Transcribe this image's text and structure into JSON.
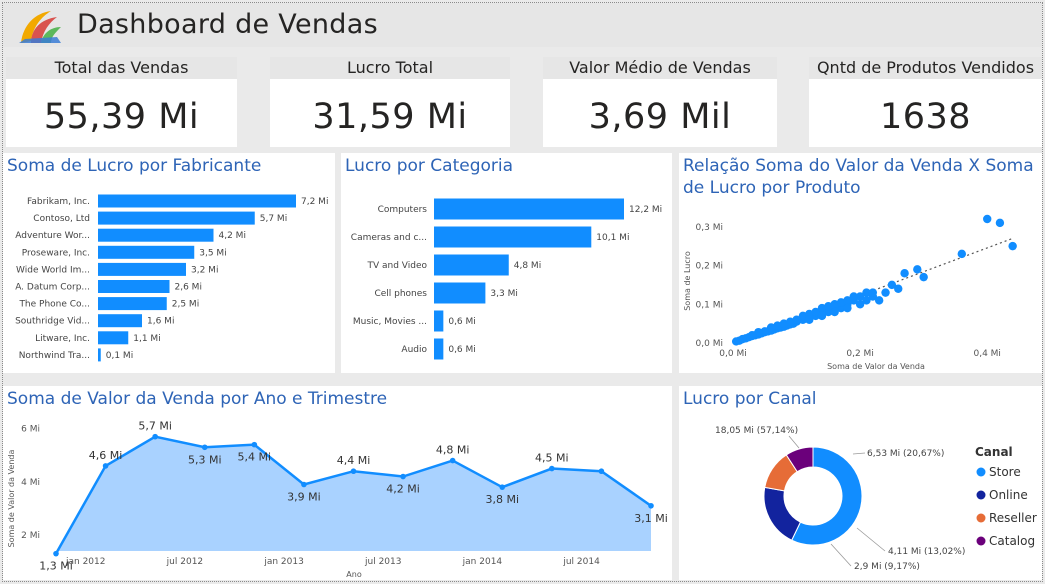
{
  "header": {
    "title": "Dashboard de Vendas"
  },
  "kpis": [
    {
      "label": "Total das Vendas",
      "value": "55,39 Mi"
    },
    {
      "label": "Lucro Total",
      "value": "31,59 Mi"
    },
    {
      "label": "Valor Médio de Vendas",
      "value": "3,69 Mil"
    },
    {
      "label": "Qntd de Produtos Vendidos",
      "value": "1638"
    }
  ],
  "colors": {
    "accent": "#118dff",
    "title": "#2e64b6",
    "area": "#a9d2ff",
    "online": "#12239e",
    "reseller": "#e66c37",
    "catalog": "#6b007b"
  },
  "chart_data": [
    {
      "type": "bar",
      "title": "Soma de Lucro por Fabricante",
      "categories": [
        "Fabrikam, Inc.",
        "Contoso, Ltd",
        "Adventure Wor...",
        "Proseware, Inc.",
        "Wide World Im...",
        "A. Datum Corp...",
        "The Phone Co...",
        "Southridge Vid...",
        "Litware, Inc.",
        "Northwind Tra..."
      ],
      "values": [
        7.2,
        5.7,
        4.2,
        3.5,
        3.2,
        2.6,
        2.5,
        1.6,
        1.1,
        0.1
      ],
      "labels": [
        "7,2 Mi",
        "5,7 Mi",
        "4,2 Mi",
        "3,5 Mi",
        "3,2 Mi",
        "2,6 Mi",
        "2,5 Mi",
        "1,6 Mi",
        "1,1 Mi",
        "0,1 Mi"
      ],
      "xlim": [
        0,
        7.2
      ]
    },
    {
      "type": "bar",
      "title": "Lucro por Categoria",
      "categories": [
        "Computers",
        "Cameras and c...",
        "TV and Video",
        "Cell phones",
        "Music, Movies ...",
        "Audio"
      ],
      "values": [
        12.2,
        10.1,
        4.8,
        3.3,
        0.6,
        0.6
      ],
      "labels": [
        "12,2 Mi",
        "10,1 Mi",
        "4,8 Mi",
        "3,3 Mi",
        "0,6 Mi",
        "0,6 Mi"
      ],
      "xlim": [
        0,
        12.2
      ]
    },
    {
      "type": "scatter",
      "title": "Relação Soma do Valor da Venda X Soma de Lucro por Produto",
      "xlabel": "Soma de Valor da Venda",
      "ylabel": "Soma de Lucro",
      "xlim": [
        0,
        0.45
      ],
      "ylim": [
        0,
        0.32
      ],
      "xticks": [
        {
          "v": 0,
          "label": "0,0 Mi"
        },
        {
          "v": 0.2,
          "label": "0,2 Mi"
        },
        {
          "v": 0.4,
          "label": "0,4 Mi"
        }
      ],
      "yticks": [
        {
          "v": 0,
          "label": "0,0 Mi"
        },
        {
          "v": 0.1,
          "label": "0,1 Mi"
        },
        {
          "v": 0.2,
          "label": "0,2 Mi"
        },
        {
          "v": 0.3,
          "label": "0,3 Mi"
        }
      ],
      "trend": [
        [
          0,
          0.0
        ],
        [
          0.44,
          0.27
        ]
      ],
      "points": [
        [
          0.4,
          0.32
        ],
        [
          0.42,
          0.31
        ],
        [
          0.44,
          0.25
        ],
        [
          0.36,
          0.23
        ],
        [
          0.27,
          0.18
        ],
        [
          0.29,
          0.19
        ],
        [
          0.3,
          0.17
        ],
        [
          0.25,
          0.15
        ],
        [
          0.26,
          0.14
        ],
        [
          0.24,
          0.13
        ],
        [
          0.21,
          0.13
        ],
        [
          0.22,
          0.12
        ],
        [
          0.23,
          0.11
        ],
        [
          0.2,
          0.12
        ],
        [
          0.19,
          0.11
        ],
        [
          0.18,
          0.1
        ],
        [
          0.17,
          0.09
        ],
        [
          0.16,
          0.085
        ],
        [
          0.15,
          0.08
        ],
        [
          0.14,
          0.075
        ],
        [
          0.13,
          0.07
        ],
        [
          0.12,
          0.065
        ],
        [
          0.11,
          0.06
        ],
        [
          0.1,
          0.055
        ],
        [
          0.095,
          0.05
        ],
        [
          0.09,
          0.048
        ],
        [
          0.085,
          0.045
        ],
        [
          0.08,
          0.042
        ],
        [
          0.075,
          0.04
        ],
        [
          0.07,
          0.038
        ],
        [
          0.065,
          0.035
        ],
        [
          0.06,
          0.032
        ],
        [
          0.055,
          0.03
        ],
        [
          0.05,
          0.028
        ],
        [
          0.045,
          0.025
        ],
        [
          0.04,
          0.022
        ],
        [
          0.035,
          0.02
        ],
        [
          0.03,
          0.018
        ],
        [
          0.025,
          0.015
        ],
        [
          0.02,
          0.012
        ],
        [
          0.015,
          0.01
        ],
        [
          0.01,
          0.006
        ],
        [
          0.005,
          0.004
        ],
        [
          0.11,
          0.07
        ],
        [
          0.12,
          0.075
        ],
        [
          0.13,
          0.08
        ],
        [
          0.14,
          0.09
        ],
        [
          0.15,
          0.095
        ],
        [
          0.16,
          0.1
        ],
        [
          0.17,
          0.105
        ],
        [
          0.18,
          0.11
        ],
        [
          0.19,
          0.12
        ],
        [
          0.2,
          0.1
        ],
        [
          0.21,
          0.11
        ],
        [
          0.22,
          0.13
        ],
        [
          0.07,
          0.045
        ],
        [
          0.08,
          0.05
        ],
        [
          0.09,
          0.055
        ],
        [
          0.1,
          0.06
        ],
        [
          0.06,
          0.04
        ],
        [
          0.05,
          0.03
        ],
        [
          0.04,
          0.028
        ],
        [
          0.03,
          0.02
        ],
        [
          0.12,
          0.06
        ],
        [
          0.14,
          0.07
        ],
        [
          0.16,
          0.08
        ],
        [
          0.18,
          0.09
        ]
      ]
    },
    {
      "type": "area",
      "title": "Soma de Valor da Venda por Ano e Trimestre",
      "xlabel": "Ano",
      "ylabel": "Soma de Valor da Venda",
      "ylim": [
        1.4,
        6.1
      ],
      "yticks": [
        {
          "v": 2,
          "label": "2 Mi"
        },
        {
          "v": 4,
          "label": "4 Mi"
        },
        {
          "v": 6,
          "label": "6 Mi"
        }
      ],
      "xticks": [
        {
          "i": 0.6,
          "label": "jan 2012"
        },
        {
          "i": 2.6,
          "label": "jul 2012"
        },
        {
          "i": 4.6,
          "label": "jan 2013"
        },
        {
          "i": 6.6,
          "label": "jul 2013"
        },
        {
          "i": 8.6,
          "label": "jan 2014"
        },
        {
          "i": 10.6,
          "label": "jul 2014"
        }
      ],
      "values": [
        1.3,
        4.6,
        5.7,
        5.3,
        5.4,
        3.9,
        4.4,
        4.2,
        4.8,
        3.8,
        4.5,
        4.4,
        3.1
      ],
      "labels": [
        "1,3 Mi",
        "4,6 Mi",
        "5,7 Mi",
        "5,3 Mi",
        "5,4 Mi",
        "3,9 Mi",
        "4,4 Mi",
        "4,2 Mi",
        "4,8 Mi",
        "3,8 Mi",
        "4,5 Mi",
        "",
        "3,1 Mi"
      ],
      "label_pos": [
        "below",
        "above",
        "above",
        "below",
        "below",
        "below",
        "above",
        "below",
        "above",
        "below",
        "above",
        "none",
        "below"
      ]
    },
    {
      "type": "pie",
      "title": "Lucro por Canal",
      "legend_title": "Canal",
      "slices": [
        {
          "name": "Store",
          "value": 57.14,
          "label": "18,05 Mi (57,14%)",
          "color": "#118dff"
        },
        {
          "name": "Online",
          "value": 20.67,
          "label": "6,53 Mi (20,67%)",
          "color": "#12239e"
        },
        {
          "name": "Reseller",
          "value": 13.02,
          "label": "4,11 Mi (13,02%)",
          "color": "#e66c37"
        },
        {
          "name": "Catalog",
          "value": 9.17,
          "label": "2,9 Mi (9,17%)",
          "color": "#6b007b"
        }
      ]
    }
  ]
}
